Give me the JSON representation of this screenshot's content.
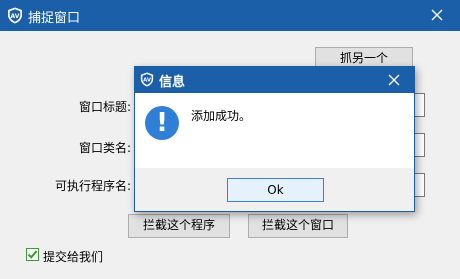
{
  "window": {
    "title": "捕捉窗口"
  },
  "buttons": {
    "grab_another": "抓另一个",
    "block_program": "拦截这个程序",
    "block_window": "拦截这个窗口"
  },
  "fields": {
    "window_title_label": "窗口标题:",
    "window_class_label": "窗口类名:",
    "executable_label": "可执行程序名:"
  },
  "checkbox": {
    "label": "提交给我们",
    "checked": true
  },
  "dialog": {
    "title": "信息",
    "message": "添加成功。",
    "ok_label": "Ok"
  },
  "colors": {
    "titlebar": "#1a5fa8",
    "info_icon": "#2f7fd7",
    "check": "#2e9b2e"
  }
}
